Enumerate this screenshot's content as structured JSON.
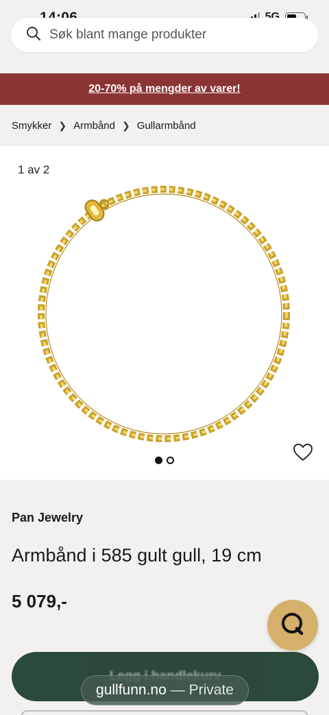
{
  "status_bar": {
    "time": "14:06",
    "network": "5G",
    "icons": [
      "signal-icon",
      "battery-icon"
    ]
  },
  "search": {
    "placeholder": "Søk blant mange produkter",
    "icon": "search-icon"
  },
  "promo": {
    "text": "20-70% på mengder av varer!",
    "color": "#8b3434"
  },
  "breadcrumb": {
    "items": [
      "Smykker",
      "Armbånd",
      "Gullarmbånd"
    ],
    "separator_icon": "chevron-right-icon"
  },
  "gallery": {
    "counter": "1 av 2",
    "image_count": 2,
    "active_index": 0,
    "wishlist_icon": "heart-icon"
  },
  "product": {
    "brand": "Pan Jewelry",
    "title": "Armbånd i 585 gult gull, 19 cm",
    "price": "5 079,-"
  },
  "cart_button": {
    "label": "Legg i handlekurv",
    "color": "#21402f"
  },
  "chat": {
    "icon": "chat-icon",
    "color": "#d4b06a"
  },
  "browser": {
    "domain": "gullfunn.no",
    "mode": "— Private"
  }
}
